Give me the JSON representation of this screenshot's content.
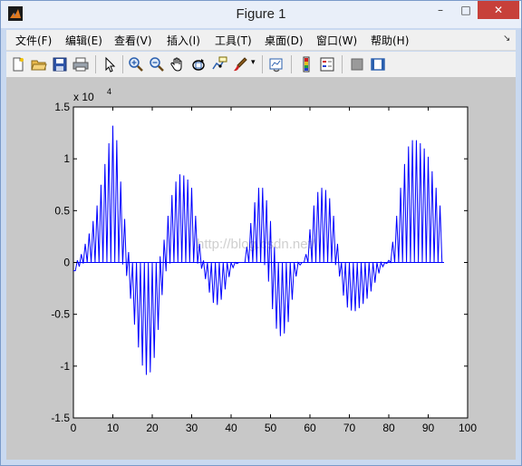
{
  "window": {
    "title": "Figure 1",
    "minimize_icon": "minimize-icon",
    "maximize_icon": "maximize-icon",
    "close_icon": "close-icon",
    "close_color": "#c7403a"
  },
  "menubar": {
    "items": [
      {
        "label": "文件(F)"
      },
      {
        "label": "编辑(E)"
      },
      {
        "label": "查看(V)"
      },
      {
        "label": "插入(I)"
      },
      {
        "label": "工具(T)"
      },
      {
        "label": "桌面(D)"
      },
      {
        "label": "窗口(W)"
      },
      {
        "label": "帮助(H)"
      }
    ]
  },
  "toolbar": {
    "buttons": [
      {
        "icon": "new-figure-icon"
      },
      {
        "icon": "open-file-icon"
      },
      {
        "icon": "save-icon"
      },
      {
        "icon": "print-icon"
      },
      {
        "icon": "edit-plot-arrow-icon"
      },
      {
        "icon": "zoom-in-icon"
      },
      {
        "icon": "zoom-out-icon"
      },
      {
        "icon": "pan-hand-icon"
      },
      {
        "icon": "rotate-3d-icon"
      },
      {
        "icon": "data-cursor-icon"
      },
      {
        "icon": "brush-icon"
      },
      {
        "icon": "link-plot-icon"
      },
      {
        "icon": "colorbar-icon"
      },
      {
        "icon": "legend-icon"
      },
      {
        "icon": "hide-plot-tools-icon"
      },
      {
        "icon": "show-plot-tools-icon"
      }
    ]
  },
  "chart_data": {
    "type": "line",
    "title": "",
    "xlabel": "",
    "ylabel": "",
    "exponent_label": "x 10",
    "exponent_power": "4",
    "xlim": [
      0,
      100
    ],
    "ylim": [
      -1.5,
      1.5
    ],
    "xticks": [
      "0",
      "10",
      "20",
      "30",
      "40",
      "50",
      "60",
      "70",
      "80",
      "90",
      "100"
    ],
    "yticks": [
      "1.5",
      "1",
      "0.5",
      "0",
      "-0.5",
      "-1",
      "-1.5"
    ],
    "grid": false,
    "line_color": "#0000ff",
    "background": "#ffffff",
    "watermark": "http://blog.csdn.net/",
    "series": [
      {
        "envelope_x": [
          0,
          1,
          2,
          3,
          4,
          5,
          6,
          7,
          8,
          9,
          10,
          11,
          12,
          13,
          14,
          15,
          16,
          17,
          18,
          19,
          20,
          21,
          22,
          23,
          24,
          25,
          26,
          27,
          28,
          29,
          30,
          31,
          32,
          33,
          34,
          35,
          36,
          37,
          38,
          39,
          40,
          41,
          42,
          43,
          44,
          45,
          46,
          47,
          48,
          49,
          50,
          51,
          52,
          53,
          54,
          55,
          56,
          57,
          58,
          59,
          60,
          61,
          62,
          63,
          64,
          65,
          66,
          67,
          68,
          69,
          70,
          71,
          72,
          73,
          74,
          75,
          76,
          77,
          78,
          79,
          80,
          81,
          82,
          83,
          84,
          85,
          86,
          87,
          88,
          89,
          90,
          91,
          92,
          93,
          94
        ],
        "envelope_max": [
          -0.08,
          0.02,
          0.08,
          0.18,
          0.28,
          0.4,
          0.55,
          0.75,
          0.95,
          1.15,
          1.32,
          1.18,
          0.78,
          0.42,
          0.1,
          0.0,
          0.0,
          0.0,
          0.0,
          0.0,
          0.0,
          0.0,
          0.06,
          0.22,
          0.45,
          0.65,
          0.78,
          0.85,
          0.84,
          0.8,
          0.72,
          0.45,
          0.18,
          0.02,
          0.0,
          0.0,
          0.0,
          0.0,
          0.0,
          0.0,
          0.0,
          0.0,
          0.0,
          0.0,
          0.15,
          0.38,
          0.58,
          0.72,
          0.72,
          0.6,
          0.4,
          0.15,
          0.0,
          0.0,
          0.0,
          0.0,
          0.0,
          0.0,
          0.0,
          0.08,
          0.32,
          0.55,
          0.68,
          0.72,
          0.7,
          0.62,
          0.45,
          0.18,
          0.0,
          0.0,
          0.0,
          0.0,
          0.0,
          0.0,
          0.0,
          0.0,
          0.0,
          0.0,
          0.0,
          0.0,
          0.02,
          0.2,
          0.45,
          0.72,
          0.95,
          1.12,
          1.18,
          1.18,
          1.15,
          1.1,
          1.02,
          0.88,
          0.72,
          0.55,
          0.0
        ],
        "envelope_min": [
          -0.1,
          -0.06,
          -0.02,
          0.0,
          0.0,
          0.0,
          0.0,
          0.0,
          0.0,
          0.0,
          0.0,
          0.0,
          0.0,
          -0.04,
          -0.22,
          -0.48,
          -0.72,
          -0.92,
          -1.07,
          -1.1,
          -1.02,
          -0.82,
          -0.48,
          -0.15,
          -0.02,
          0.0,
          0.0,
          0.0,
          0.0,
          0.0,
          0.0,
          0.0,
          -0.02,
          -0.1,
          -0.22,
          -0.36,
          -0.42,
          -0.4,
          -0.32,
          -0.2,
          -0.08,
          -0.02,
          0.0,
          0.0,
          0.0,
          0.0,
          0.0,
          0.0,
          0.0,
          -0.05,
          -0.32,
          -0.58,
          -0.7,
          -0.72,
          -0.65,
          -0.5,
          -0.22,
          -0.05,
          0.0,
          0.0,
          0.0,
          0.0,
          0.0,
          0.0,
          0.0,
          0.0,
          0.0,
          -0.05,
          -0.22,
          -0.42,
          -0.45,
          -0.48,
          -0.46,
          -0.42,
          -0.38,
          -0.32,
          -0.24,
          -0.15,
          -0.06,
          -0.02,
          0.0,
          0.0,
          0.0,
          0.0,
          0.0,
          0.0,
          0.0,
          0.0,
          0.0,
          0.0,
          0.0,
          0.0,
          0.0,
          0.0,
          0.0
        ],
        "samples_per_unit": 2
      }
    ]
  }
}
